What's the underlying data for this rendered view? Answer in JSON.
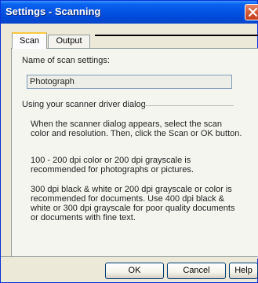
{
  "window": {
    "title": "Settings - Scanning"
  },
  "tabs": [
    {
      "label": "Scan",
      "active": true
    },
    {
      "label": "Output",
      "active": false
    }
  ],
  "scan_panel": {
    "name_label": "Name of scan settings:",
    "name_value": "Photograph",
    "group_label": "Using your scanner driver dialog",
    "paragraphs": [
      "When the scanner dialog appears, select the scan color and resolution. Then, click the Scan or OK button.",
      "100 - 200 dpi color or 200 dpi grayscale is recommended for photographs or pictures.",
      "300 dpi black & white or 200 dpi grayscale or color is recommended for documents. Use 400 dpi black & white or 300 dpi grayscale for poor quality documents or documents with fine text."
    ]
  },
  "buttons": {
    "ok": "OK",
    "cancel": "Cancel",
    "help": "Help"
  },
  "colors": {
    "titlebar": "#0454e4",
    "close_button": "#d35a37",
    "active_tab_highlight": "#ffc83c"
  }
}
